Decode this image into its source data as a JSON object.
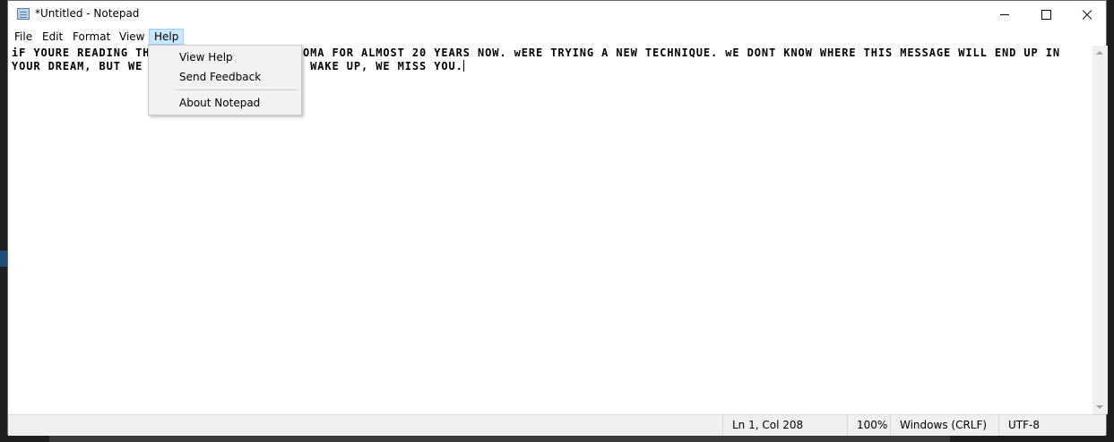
{
  "window": {
    "title": "*Untitled - Notepad"
  },
  "menubar": {
    "items": [
      "File",
      "Edit",
      "Format",
      "View",
      "Help"
    ]
  },
  "editor": {
    "content": "iF YOURE READING THIS, YOUVE BEEN IN A COMA FOR ALMOST 20 YEARS NOW. wERE TRYING A NEW TECHNIQUE. wE DONT KNOW WHERE THIS MESSAGE WILL END UP IN YOUR DREAM, BUT WE HOPE IT WORKS. pLEASE WAKE UP, WE MISS YOU."
  },
  "help_menu": {
    "items": [
      "View Help",
      "Send Feedback",
      "About Notepad"
    ]
  },
  "statusbar": {
    "position": "Ln 1, Col 208",
    "zoom": "100%",
    "line_ending": "Windows (CRLF)",
    "encoding": "UTF-8"
  },
  "icons": [
    "notepad-app-icon",
    "minimize-icon",
    "maximize-icon",
    "close-icon",
    "scroll-up-icon",
    "scroll-down-icon"
  ],
  "colors": {
    "menu_highlight": "#cce8ff",
    "menu_highlight_border": "#99d1ff",
    "dropdown_bg": "#f2f2f2"
  }
}
